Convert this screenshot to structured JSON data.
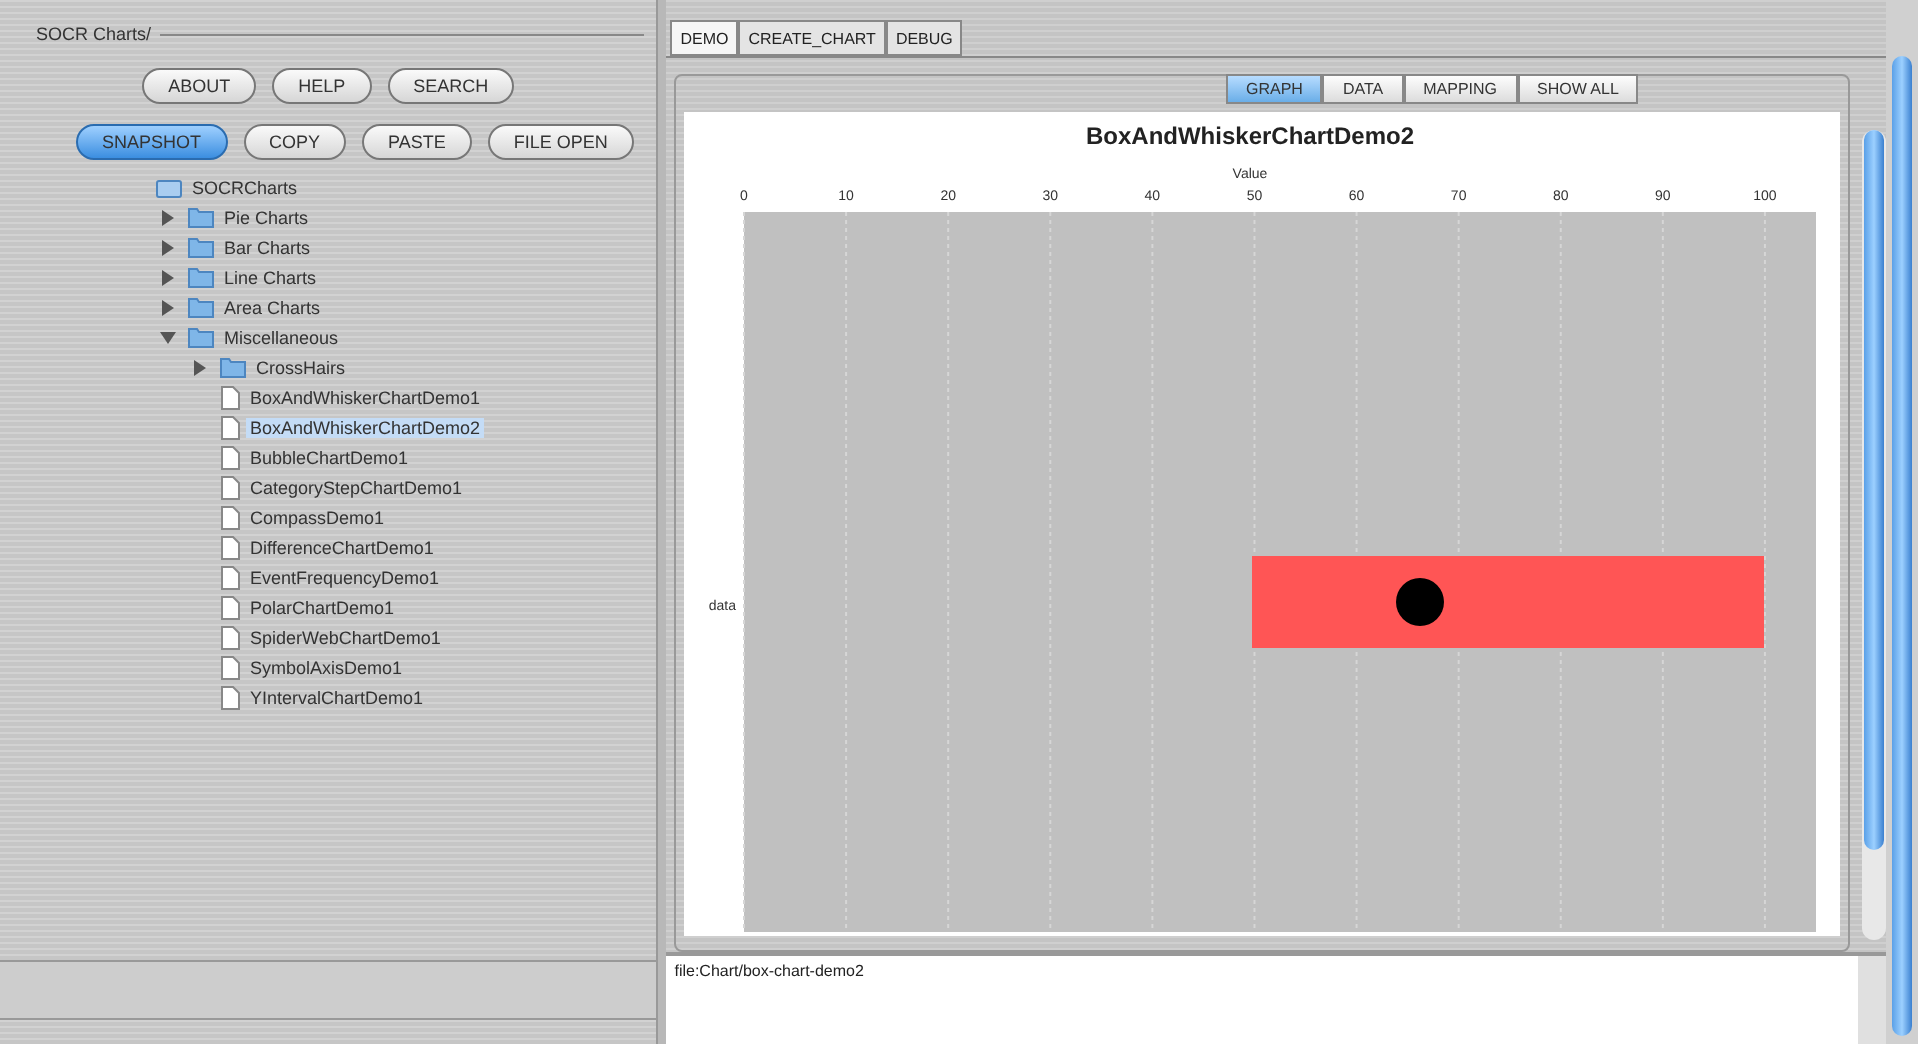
{
  "left_panel": {
    "title": "SOCR Charts/",
    "buttons": [
      {
        "label": "ABOUT",
        "selected": false
      },
      {
        "label": "HELP",
        "selected": false
      },
      {
        "label": "SEARCH",
        "selected": false
      }
    ],
    "buttons_2": [
      {
        "label": "SNAPSHOT",
        "selected": true
      },
      {
        "label": "COPY",
        "selected": false
      },
      {
        "label": "PASTE",
        "selected": false
      },
      {
        "label": "FILE OPEN",
        "selected": false
      }
    ],
    "tree": [
      {
        "label": "SOCRCharts",
        "kind": "root",
        "selected": false,
        "children": [
          {
            "label": "Pie Charts",
            "kind": "folder",
            "expanded": false,
            "selected": false
          },
          {
            "label": "Bar Charts",
            "kind": "folder",
            "expanded": false,
            "selected": false
          },
          {
            "label": "Line Charts",
            "kind": "folder",
            "expanded": false,
            "selected": false
          },
          {
            "label": "Area Charts",
            "kind": "folder",
            "expanded": false,
            "selected": false
          },
          {
            "label": "Miscellaneous",
            "kind": "folder",
            "expanded": true,
            "selected": false,
            "children": [
              {
                "label": "CrossHairs",
                "kind": "folder",
                "expanded": false,
                "selected": false
              },
              {
                "label": "BoxAndWhiskerChartDemo1",
                "kind": "file",
                "selected": false
              },
              {
                "label": "BoxAndWhiskerChartDemo2",
                "kind": "file",
                "selected": true
              },
              {
                "label": "BubbleChartDemo1",
                "kind": "file",
                "selected": false
              },
              {
                "label": "CategoryStepChartDemo1",
                "kind": "file",
                "selected": false
              },
              {
                "label": "CompassDemo1",
                "kind": "file",
                "selected": false
              },
              {
                "label": "DifferenceChartDemo1",
                "kind": "file",
                "selected": false
              },
              {
                "label": "EventFrequencyDemo1",
                "kind": "file",
                "selected": false
              },
              {
                "label": "PolarChartDemo1",
                "kind": "file",
                "selected": false
              },
              {
                "label": "SpiderWebChartDemo1",
                "kind": "file",
                "selected": false
              },
              {
                "label": "SymbolAxisDemo1",
                "kind": "file",
                "selected": false
              },
              {
                "label": "YIntervalChartDemo1",
                "kind": "file",
                "selected": false
              }
            ]
          }
        ]
      }
    ]
  },
  "tabs": [
    {
      "label": "DEMO",
      "selected": true
    },
    {
      "label": "CREATE_CHART",
      "selected": false
    },
    {
      "label": "DEBUG",
      "selected": false
    }
  ],
  "view_tabs": [
    {
      "label": "GRAPH",
      "selected": true
    },
    {
      "label": "DATA",
      "selected": false
    },
    {
      "label": "MAPPING",
      "selected": false
    },
    {
      "label": "SHOW ALL",
      "selected": false
    }
  ],
  "chart_data": {
    "type": "bar",
    "orientation": "horizontal",
    "title": "BoxAndWhiskerChartDemo2",
    "xlabel": "Value",
    "categories": [
      "data"
    ],
    "xlim": [
      0,
      105
    ],
    "xticks": [
      0,
      10,
      20,
      30,
      40,
      50,
      60,
      70,
      80,
      90,
      100
    ],
    "grid": true
  },
  "status_text": "file:Chart/box-chart-demo2"
}
